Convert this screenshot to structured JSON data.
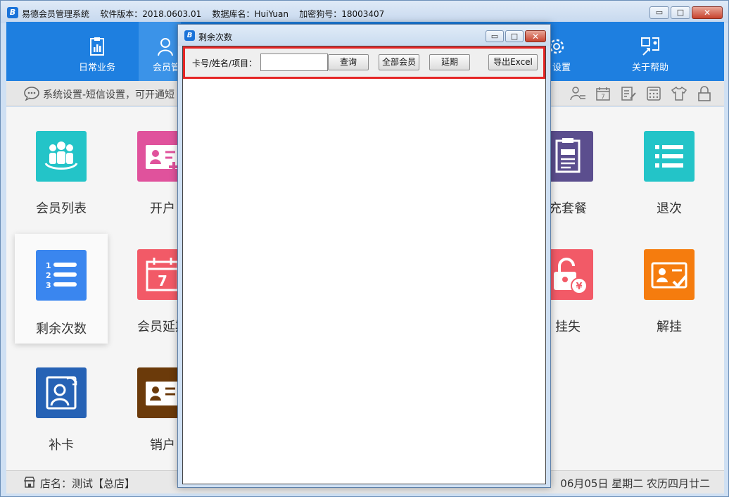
{
  "window": {
    "title": "易德会员管理系统    软件版本：2018.0603.01    数据库名：HuiYuan    加密狗号：18003407",
    "logo_glyph": "B",
    "minimize_glyph": "▭",
    "maximize_glyph": "□",
    "close_glyph": "✕"
  },
  "nav": {
    "items": [
      {
        "label": "日常业务",
        "icon": "clipboard-chart-icon"
      },
      {
        "label": "会员管",
        "icon": "member-icon",
        "active": true
      },
      {
        "label": "设置",
        "icon": "gear-icon"
      },
      {
        "label": "关于帮助",
        "icon": "help-icon"
      }
    ]
  },
  "status": {
    "message": "系统设置-短信设置，可开通短"
  },
  "tiles": [
    {
      "label": "会员列表",
      "icon": "member-group-icon",
      "color": "#23c4c8"
    },
    {
      "label": "开户",
      "icon": "id-card-add-icon",
      "color": "#e0529c"
    },
    {
      "label": "充套餐",
      "icon": "document-icon",
      "color": "#5b4e8e"
    },
    {
      "label": "退次",
      "icon": "list-icon",
      "color": "#23c4c8"
    },
    {
      "label": "剩余次数",
      "icon": "numbered-list-icon",
      "color": "#3a86ef"
    },
    {
      "label": "会员延期",
      "icon": "calendar-icon",
      "color": "#f25a67"
    },
    {
      "label": "挂失",
      "icon": "lock-yen-icon",
      "color": "#f25a67"
    },
    {
      "label": "解挂",
      "icon": "card-check-icon",
      "color": "#f57c0e"
    },
    {
      "label": "补卡",
      "icon": "reissue-card-icon",
      "color": "#2662b5"
    },
    {
      "label": "销户",
      "icon": "id-card-remove-icon",
      "color": "#6b3a0a"
    }
  ],
  "footer": {
    "shop": "店名：测试【总店】",
    "date": "06月05日 星期二 农历四月廿二"
  },
  "dialog": {
    "title": "剩余次数",
    "logo_glyph": "B",
    "search_label": "卡号/姓名/项目：",
    "search_value": "",
    "buttons": {
      "query": "查询",
      "all_members": "全部会员",
      "extend": "延期",
      "export": "导出Excel"
    }
  }
}
